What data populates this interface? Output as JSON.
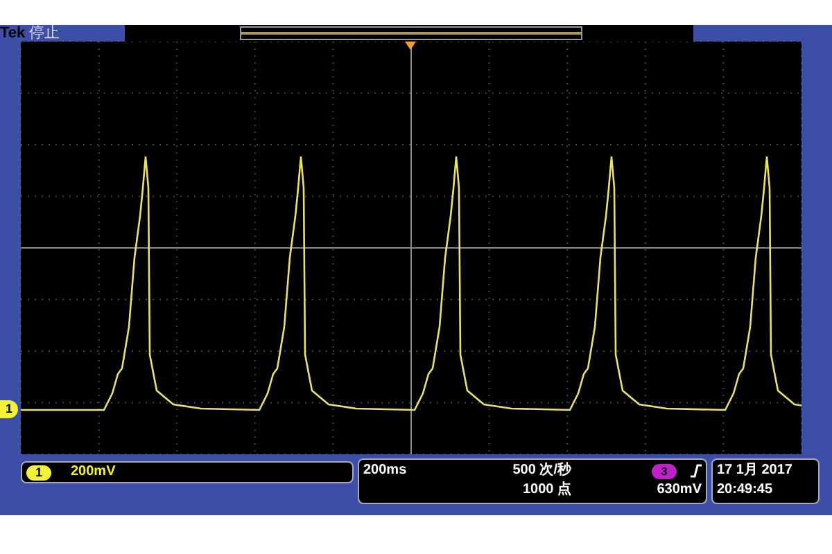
{
  "header": {
    "brand": "Tek",
    "status": "停止"
  },
  "ground_marker": "1",
  "channel": {
    "badge": "1",
    "scale": "200mV"
  },
  "timebase": {
    "scale": "200ms",
    "sample_rate": "500 次/秒",
    "record_length": "1000 点"
  },
  "trigger": {
    "source": "3",
    "level": "630mV"
  },
  "datetime": {
    "date": "17 1月 2017",
    "time": "20:49:45"
  }
}
